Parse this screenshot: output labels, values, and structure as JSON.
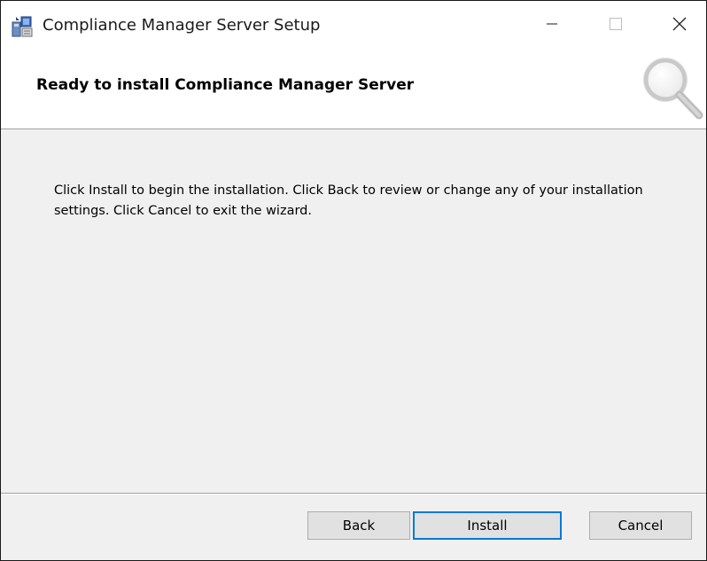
{
  "window": {
    "title": "Compliance Manager Server Setup"
  },
  "header": {
    "title": "Ready to install Compliance Manager Server",
    "icon": "magnifier-icon"
  },
  "body": {
    "text": "Click Install to begin the installation. Click Back to review or change any of your installation settings. Click Cancel to exit the wizard."
  },
  "buttons": {
    "back": "Back",
    "install": "Install",
    "cancel": "Cancel"
  },
  "colors": {
    "focus_border": "#0078d7",
    "button_face": "#e1e1e1",
    "dialog_background": "#f0f0f0"
  }
}
